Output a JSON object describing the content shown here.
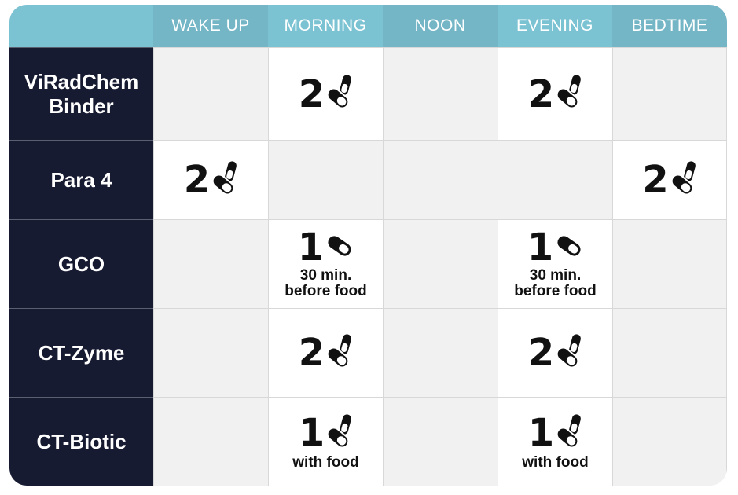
{
  "columns": [
    "WAKE UP",
    "MORNING",
    "NOON",
    "EVENING",
    "BEDTIME"
  ],
  "rows": [
    {
      "name": "ViRadChem\nBinder",
      "cells": [
        null,
        {
          "qty": "2",
          "icon": "two-pills-icon"
        },
        null,
        {
          "qty": "2",
          "icon": "two-pills-icon"
        },
        null
      ]
    },
    {
      "name": "Para 4",
      "cells": [
        {
          "qty": "2",
          "icon": "two-pills-icon"
        },
        null,
        null,
        null,
        {
          "qty": "2",
          "icon": "two-pills-icon"
        }
      ]
    },
    {
      "name": "GCO",
      "cells": [
        null,
        {
          "qty": "1",
          "icon": "single-pill-icon",
          "note": "30 min.\nbefore food"
        },
        null,
        {
          "qty": "1",
          "icon": "single-pill-icon",
          "note": "30 min.\nbefore food"
        },
        null
      ]
    },
    {
      "name": "CT-Zyme",
      "cells": [
        null,
        {
          "qty": "2",
          "icon": "two-pills-icon"
        },
        null,
        {
          "qty": "2",
          "icon": "two-pills-icon"
        },
        null
      ]
    },
    {
      "name": "CT-Biotic",
      "cells": [
        null,
        {
          "qty": "1",
          "icon": "two-pills-icon",
          "note": "with food"
        },
        null,
        {
          "qty": "1",
          "icon": "two-pills-icon",
          "note": "with food"
        },
        null
      ]
    }
  ],
  "colors": {
    "header_light": "#7bc3d3",
    "header_dark": "#74b6c6",
    "name_bg": "#171b31",
    "cell_white": "#ffffff",
    "cell_gray": "#f1f1f1"
  }
}
